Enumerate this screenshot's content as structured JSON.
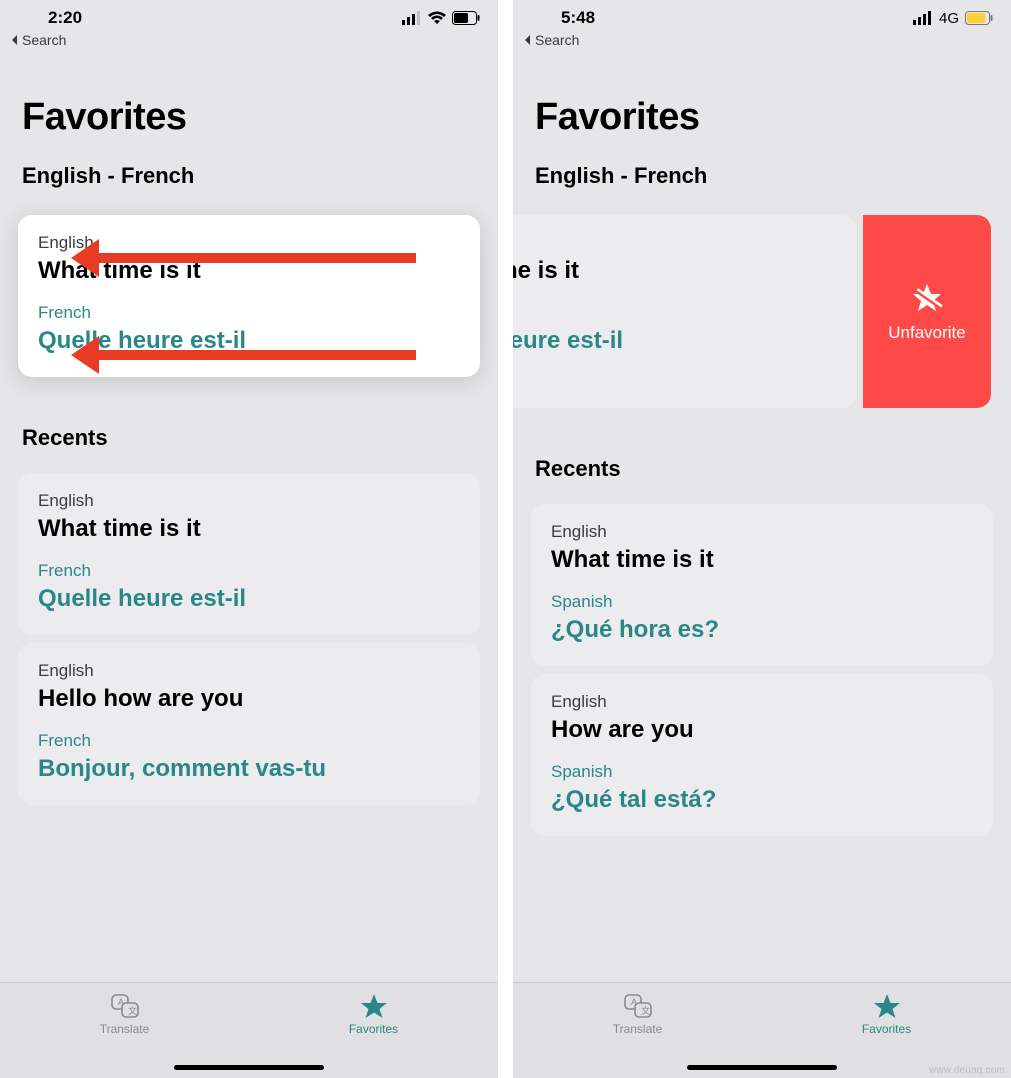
{
  "left": {
    "status": {
      "time": "2:20",
      "back_label": "Search"
    },
    "title": "Favorites",
    "pair": "English - French",
    "fav_card": {
      "src_lang": "English",
      "src_text": "What time is it",
      "tgt_lang": "French",
      "tgt_text": "Quelle heure est-il"
    },
    "recents_label": "Recents",
    "recents": [
      {
        "src_lang": "English",
        "src_text": "What time is it",
        "tgt_lang": "French",
        "tgt_text": "Quelle heure est-il"
      },
      {
        "src_lang": "English",
        "src_text": "Hello how are you",
        "tgt_lang": "French",
        "tgt_text": "Bonjour, comment vas-tu"
      }
    ],
    "tabs": {
      "translate": "Translate",
      "favorites": "Favorites"
    }
  },
  "right": {
    "status": {
      "time": "5:48",
      "network": "4G",
      "back_label": "Search"
    },
    "title": "Favorites",
    "pair": "English - French",
    "swiped": {
      "src_text_partial": "ne is it",
      "tgt_text_partial": "ıeure est-il",
      "unfav_label": "Unfavorite"
    },
    "recents_label": "Recents",
    "recents": [
      {
        "src_lang": "English",
        "src_text": "What time is it",
        "tgt_lang": "Spanish",
        "tgt_text": "¿Qué hora es?"
      },
      {
        "src_lang": "English",
        "src_text": "How are you",
        "tgt_lang": "Spanish",
        "tgt_text": "¿Qué tal está?"
      }
    ],
    "tabs": {
      "translate": "Translate",
      "favorites": "Favorites"
    }
  },
  "watermark": "www.deuaq.com"
}
